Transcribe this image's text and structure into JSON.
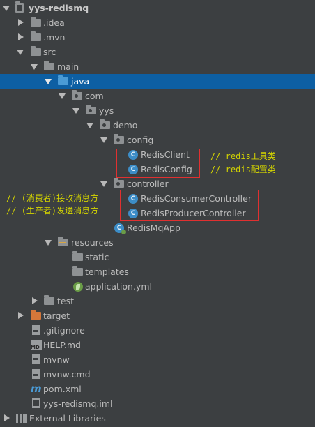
{
  "tree": {
    "project_label": "yys-redismq",
    "idea": ".idea",
    "mvn": ".mvn",
    "src": "src",
    "main": "main",
    "java": "java",
    "com": "com",
    "yys": "yys",
    "demo": "demo",
    "config": "config",
    "redis_client": "RedisClient",
    "redis_config": "RedisConfig",
    "controller": "controller",
    "consumer_controller": "RedisConsumerController",
    "producer_controller": "RedisProducerController",
    "app": "RedisMqApp",
    "resources": "resources",
    "static": "static",
    "templates": "templates",
    "application_yml": "application.yml",
    "test": "test",
    "target": "target",
    "gitignore": ".gitignore",
    "help_md": "HELP.md",
    "mvnw": "mvnw",
    "mvnw_cmd": "mvnw.cmd",
    "pom_xml": "pom.xml",
    "iml": "yys-redismq.iml",
    "external_libraries": "External Libraries"
  },
  "annotations": {
    "redis_client_comment": "// redis工具类",
    "redis_config_comment": "// redis配置类",
    "consumer_comment": "// (消费者)接收消息方",
    "producer_comment": "// (生产者)发送消息方"
  },
  "icon_text": {
    "class_letter": "C",
    "md_badge": "MD",
    "maven_letter": "m"
  },
  "colors": {
    "background": "#3c3f41",
    "selection": "#0d5fa3",
    "annotation_box": "#e03030",
    "comment_text": "#d4d400",
    "source_folder": "#4a9bd6",
    "target_folder": "#d4773a"
  },
  "selected_item": "java"
}
